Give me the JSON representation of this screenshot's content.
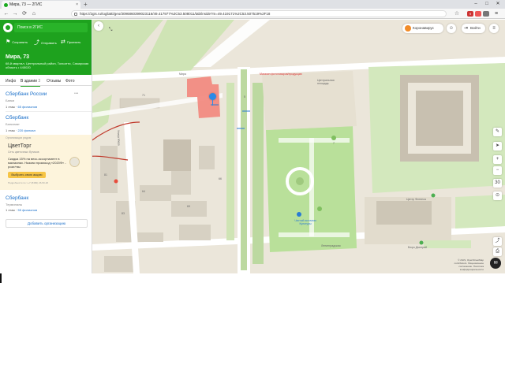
{
  "browser": {
    "tab_title": "Мира, 73 — 2ГИС",
    "tab_close": "×",
    "new_tab": "+",
    "url": "https://2gis.ru/togliatti/geo/3096860399023116/49.417977%2C53.508011/tab/inside?m=49.419171%2C53.507519%2F18",
    "ext_badge": "9"
  },
  "search": {
    "placeholder": "Поиск в 2ГИС"
  },
  "header_actions": {
    "save": "Сохранить",
    "share": "Отправить",
    "route": "Проехать"
  },
  "address": {
    "title": "Мира, 73",
    "subtitle": "6й-й квартал, Центральный район, Тольятти, Самарская область • 445020"
  },
  "panel_tabs": [
    "Инфо",
    "В здании",
    "Отзывы",
    "Фото"
  ],
  "panel_tabs_badge": "3",
  "orgs": [
    {
      "name": "Сбербанк России",
      "category": "Банки",
      "floor": "1 этаж",
      "branches": "65 филиалов"
    },
    {
      "name": "Сбербанк",
      "category": "Банкомат",
      "floor": "1 этаж",
      "branches": "220 филиал"
    },
    {
      "name": "Сбербанк",
      "category": "Терминалы",
      "floor": "1 этаж",
      "branches": "55 филиалов"
    }
  ],
  "ad": {
    "label": "Организации рядом",
    "name": "ЦветТорг",
    "category": "Сеть цветочных бутиков",
    "text": "Скидка 15% на весь ассортимент в магазинах. Назови промокод «2020Ф» - роза+вы",
    "button": "Выбрать свою акцию",
    "footer": "Подробности по т.+7 (8482) 26-50-26"
  },
  "add_org": "Добавить организацию",
  "map": {
    "corona": "Коронавирус",
    "login": "Войти",
    "labels": {
      "shop": "Магазин фототоваров/продукции",
      "square": "Центральная площадь",
      "street_top": "Мира",
      "street_bottom": "Ленинградская",
      "left_street": "Улица Мира",
      "culture": "Чистый источник Культуры",
      "fitness": "Центр Фитнеса",
      "bakery": "Бюро Дмитрий",
      "num_71": "71",
      "num_69": "69",
      "num_81": "81",
      "num_83": "83",
      "num_64": "64",
      "num_66": "66",
      "num_5": "5",
      "num_7": "7"
    },
    "copyright": "© 2GIS, OpenStreetMap contributors. Лицензионное соглашение. Политика конфиденциальности",
    "zoom_in": "+",
    "zoom_out": "−",
    "scale": "30"
  }
}
